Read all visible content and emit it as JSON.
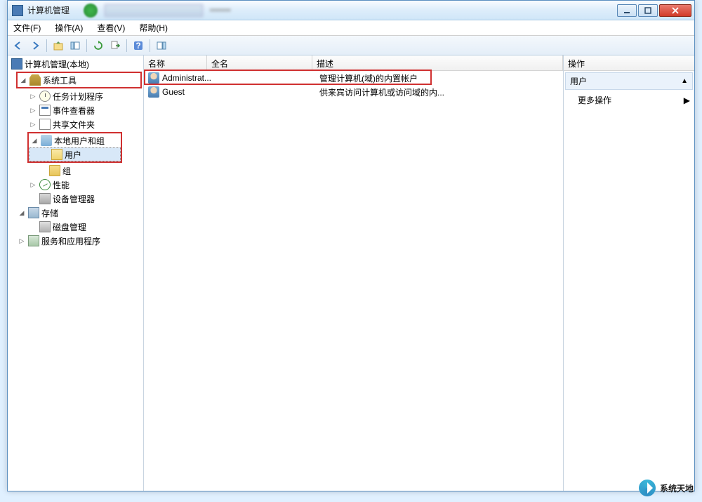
{
  "window": {
    "title": "计算机管理"
  },
  "menu": {
    "file": "文件(F)",
    "action": "操作(A)",
    "view": "查看(V)",
    "help": "帮助(H)"
  },
  "tree": {
    "root": "计算机管理(本地)",
    "system_tools": "系统工具",
    "task_scheduler": "任务计划程序",
    "event_viewer": "事件查看器",
    "shared_folders": "共享文件夹",
    "local_users_groups": "本地用户和组",
    "users": "用户",
    "groups": "组",
    "performance": "性能",
    "device_manager": "设备管理器",
    "storage": "存储",
    "disk_management": "磁盘管理",
    "services_apps": "服务和应用程序"
  },
  "list": {
    "headers": {
      "name": "名称",
      "fullname": "全名",
      "description": "描述"
    },
    "rows": [
      {
        "name": "Administrat...",
        "fullname": "",
        "description": "管理计算机(域)的内置帐户"
      },
      {
        "name": "Guest",
        "fullname": "",
        "description": "供来宾访问计算机或访问域的内..."
      }
    ]
  },
  "actions": {
    "header": "操作",
    "section": "用户",
    "more": "更多操作"
  },
  "watermark": "系统天地"
}
